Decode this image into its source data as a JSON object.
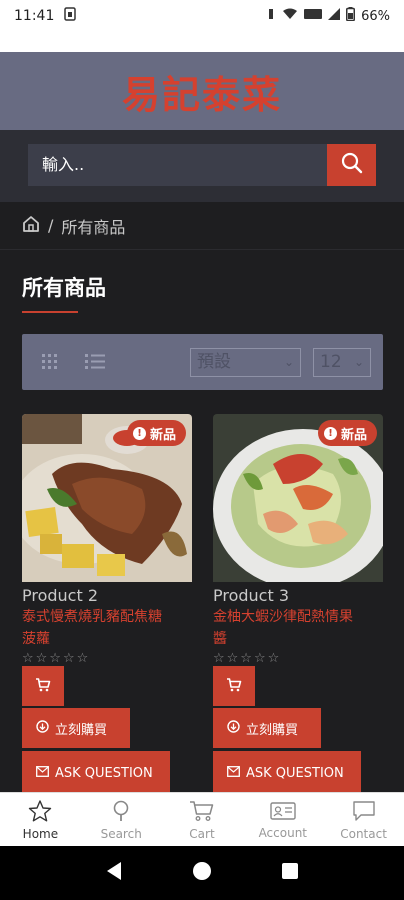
{
  "status_bar": {
    "time": "11:41",
    "battery": "66%"
  },
  "header": {
    "title": "易記泰菜"
  },
  "search": {
    "placeholder": "輸入.."
  },
  "breadcrumb": {
    "separator": "/",
    "current": "所有商品"
  },
  "section": {
    "title": "所有商品"
  },
  "toolbar": {
    "sort_value": "預設",
    "per_page_value": "12"
  },
  "products": [
    {
      "name": "Product 2",
      "description_line1": "泰式慢煮燒乳豬配焦糖",
      "description_line2": "菠蘿",
      "badge": "新品",
      "buy_label": "立刻購買",
      "ask_label": "ASK QUESTION",
      "rating": 0
    },
    {
      "name": "Product 3",
      "description_line1": "金柚大蝦沙律配熱情果",
      "description_line2": "醬",
      "badge": "新品",
      "buy_label": "立刻購買",
      "ask_label": "ASK QUESTION",
      "rating": 0
    }
  ],
  "bottom_nav": [
    {
      "label": "Home",
      "icon": "star-icon"
    },
    {
      "label": "Search",
      "icon": "magnifier-icon"
    },
    {
      "label": "Cart",
      "icon": "cart-icon"
    },
    {
      "label": "Account",
      "icon": "id-card-icon"
    },
    {
      "label": "Contact",
      "icon": "chat-bubble-icon"
    }
  ],
  "colors": {
    "accent": "#c8412f",
    "header_bg": "#686b82",
    "page_bg": "#1e1e20"
  }
}
